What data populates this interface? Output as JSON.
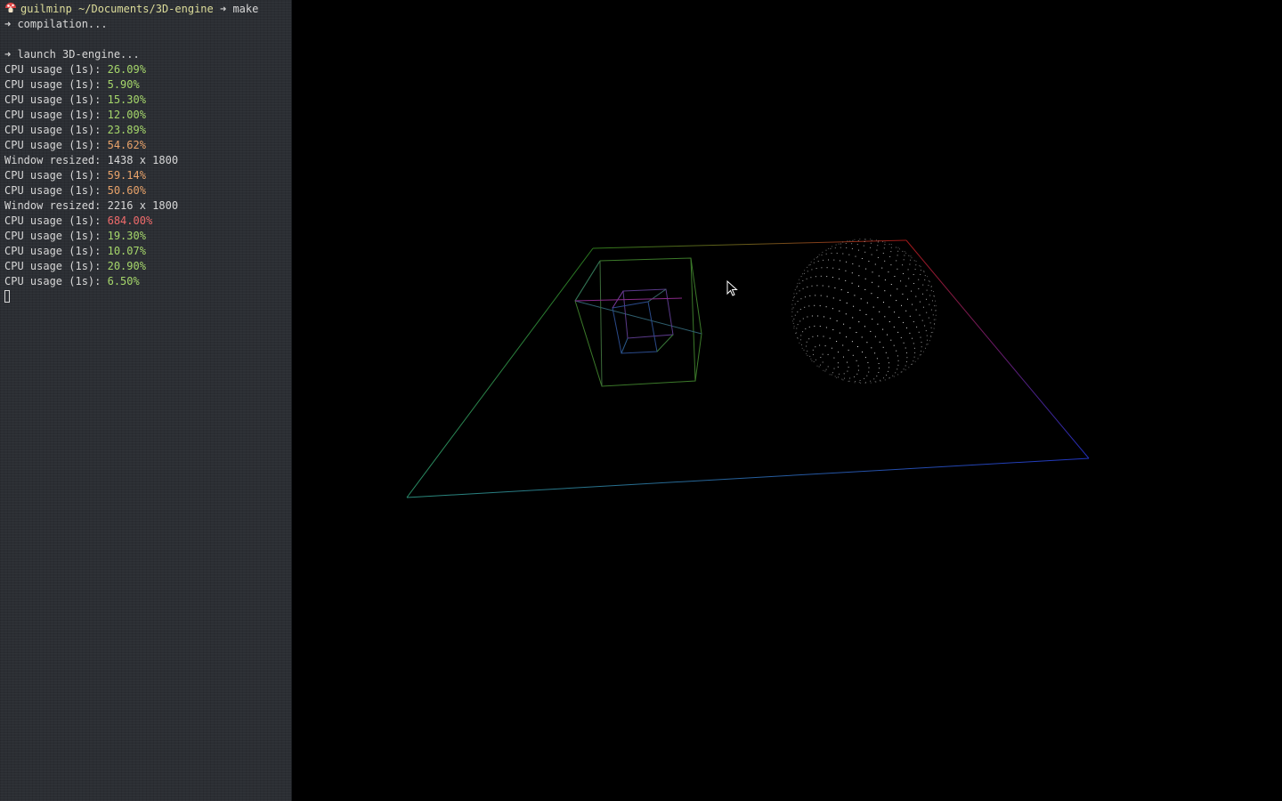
{
  "terminal": {
    "prompt_user": "guilminp",
    "prompt_path": "~/Documents/3D-engine",
    "prompt_arrow": "➜",
    "prompt_command": "make",
    "line_compilation": "➜ compilation...",
    "line_launch": "➜ launch 3D-engine...",
    "cpu_label": "CPU usage (1s): ",
    "resize_label": "Window resized: ",
    "log": [
      {
        "type": "cpu",
        "value": "26.09%",
        "level": "green"
      },
      {
        "type": "cpu",
        "value": "5.90%",
        "level": "green"
      },
      {
        "type": "cpu",
        "value": "15.30%",
        "level": "green"
      },
      {
        "type": "cpu",
        "value": "12.00%",
        "level": "green"
      },
      {
        "type": "cpu",
        "value": "23.89%",
        "level": "green"
      },
      {
        "type": "cpu",
        "value": "54.62%",
        "level": "orange"
      },
      {
        "type": "resize",
        "value": "1438 x 1800"
      },
      {
        "type": "cpu",
        "value": "59.14%",
        "level": "orange"
      },
      {
        "type": "cpu",
        "value": "50.60%",
        "level": "orange"
      },
      {
        "type": "resize",
        "value": "2216 x 1800"
      },
      {
        "type": "cpu",
        "value": "684.00%",
        "level": "red"
      },
      {
        "type": "cpu",
        "value": "19.30%",
        "level": "green"
      },
      {
        "type": "cpu",
        "value": "10.07%",
        "level": "green"
      },
      {
        "type": "cpu",
        "value": "20.90%",
        "level": "green"
      },
      {
        "type": "cpu",
        "value": "6.50%",
        "level": "green"
      }
    ]
  },
  "colors": {
    "terminal_bg": "#2b2e33",
    "text": "#d7d7d7",
    "green": "#a6d76b",
    "orange": "#e9a36a",
    "red": "#ef6b6b",
    "viewport_bg": "#000000"
  },
  "scene": {
    "objects": [
      "plane-wireframe",
      "cube-outer-wireframe",
      "cube-inner-wireframe",
      "sphere-point-cloud"
    ]
  }
}
